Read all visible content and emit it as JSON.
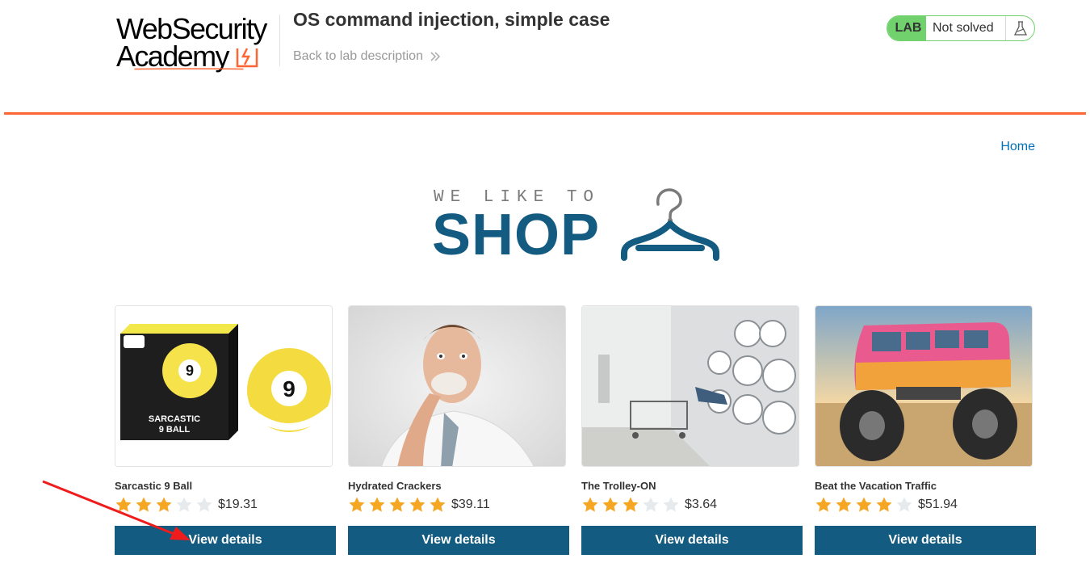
{
  "header": {
    "logo_line1": "WebSecurity",
    "logo_line2": "Academy",
    "lab_title": "OS command injection, simple case",
    "back_link": "Back to lab description",
    "lab_badge": "LAB",
    "lab_status": "Not solved",
    "flask_icon": "flask-icon"
  },
  "nav": {
    "home": "Home"
  },
  "banner": {
    "tagline": "WE LIKE TO",
    "title": "SHOP",
    "icon": "hanger-icon"
  },
  "products": [
    {
      "name": "Sarcastic 9 Ball",
      "rating": 3,
      "price": "$19.31",
      "button": "View details"
    },
    {
      "name": "Hydrated Crackers",
      "rating": 5,
      "price": "$39.11",
      "button": "View details"
    },
    {
      "name": "The Trolley-ON",
      "rating": 3,
      "price": "$3.64",
      "button": "View details"
    },
    {
      "name": "Beat the Vacation Traffic",
      "rating": 4,
      "price": "$51.94",
      "button": "View details"
    }
  ],
  "colors": {
    "accent_orange": "#ff6633",
    "lab_green": "#70d16d",
    "primary_blue": "#135b80",
    "link_blue": "#0071bc",
    "star_filled": "#f5a623",
    "star_empty": "#e6eaec",
    "annotation_red": "#ee1c1c"
  }
}
